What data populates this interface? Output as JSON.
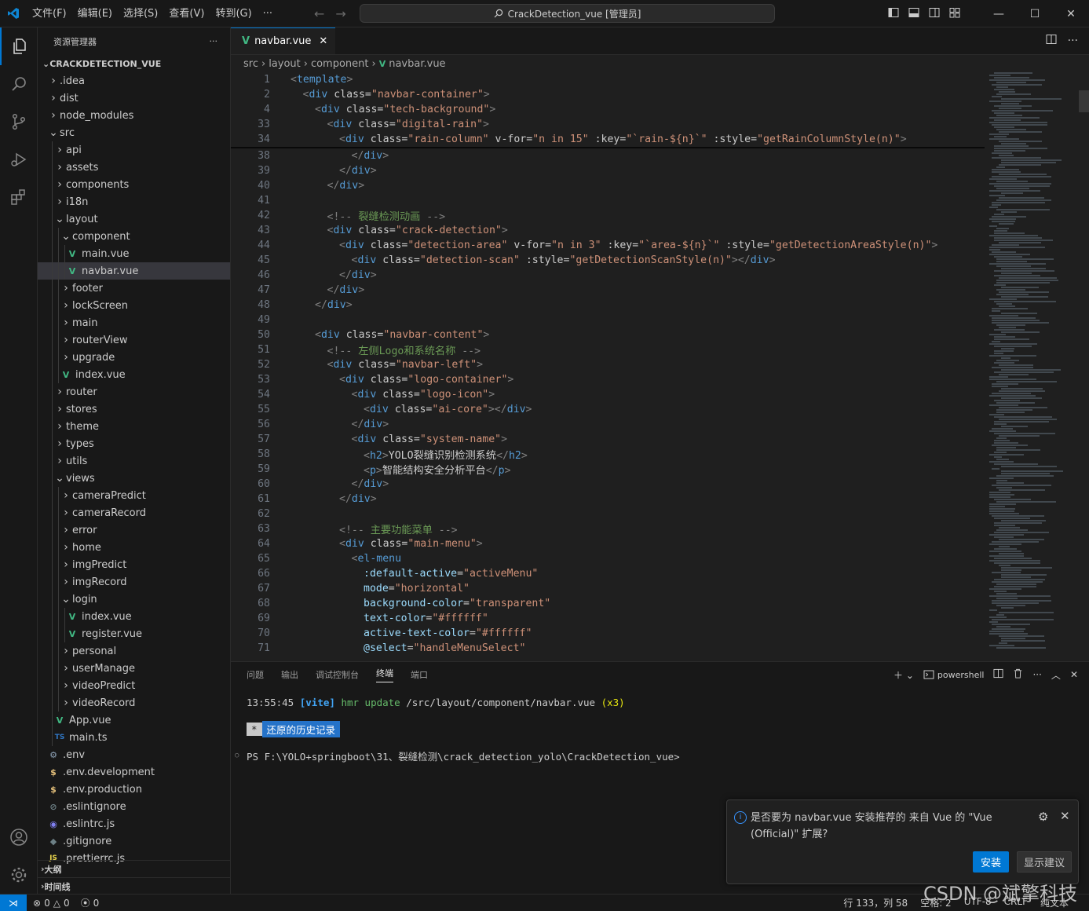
{
  "titlebar": {
    "menus": [
      "文件(F)",
      "编辑(E)",
      "选择(S)",
      "查看(V)",
      "转到(G)",
      "···"
    ],
    "search": "CrackDetection_vue [管理员]"
  },
  "sidebar": {
    "title": "资源管理器",
    "project": "CRACKDETECTION_VUE",
    "tree": [
      {
        "label": ".idea",
        "depth": 0,
        "kind": "folder"
      },
      {
        "label": "dist",
        "depth": 0,
        "kind": "folder"
      },
      {
        "label": "node_modules",
        "depth": 0,
        "kind": "folder"
      },
      {
        "label": "src",
        "depth": 0,
        "kind": "folder-open"
      },
      {
        "label": "api",
        "depth": 1,
        "kind": "folder"
      },
      {
        "label": "assets",
        "depth": 1,
        "kind": "folder"
      },
      {
        "label": "components",
        "depth": 1,
        "kind": "folder"
      },
      {
        "label": "i18n",
        "depth": 1,
        "kind": "folder"
      },
      {
        "label": "layout",
        "depth": 1,
        "kind": "folder-open"
      },
      {
        "label": "component",
        "depth": 2,
        "kind": "folder-open"
      },
      {
        "label": "main.vue",
        "depth": 3,
        "kind": "vue"
      },
      {
        "label": "navbar.vue",
        "depth": 3,
        "kind": "vue",
        "selected": true
      },
      {
        "label": "footer",
        "depth": 2,
        "kind": "folder"
      },
      {
        "label": "lockScreen",
        "depth": 2,
        "kind": "folder"
      },
      {
        "label": "main",
        "depth": 2,
        "kind": "folder"
      },
      {
        "label": "routerView",
        "depth": 2,
        "kind": "folder"
      },
      {
        "label": "upgrade",
        "depth": 2,
        "kind": "folder"
      },
      {
        "label": "index.vue",
        "depth": 2,
        "kind": "vue"
      },
      {
        "label": "router",
        "depth": 1,
        "kind": "folder"
      },
      {
        "label": "stores",
        "depth": 1,
        "kind": "folder"
      },
      {
        "label": "theme",
        "depth": 1,
        "kind": "folder"
      },
      {
        "label": "types",
        "depth": 1,
        "kind": "folder"
      },
      {
        "label": "utils",
        "depth": 1,
        "kind": "folder"
      },
      {
        "label": "views",
        "depth": 1,
        "kind": "folder-open"
      },
      {
        "label": "cameraPredict",
        "depth": 2,
        "kind": "folder"
      },
      {
        "label": "cameraRecord",
        "depth": 2,
        "kind": "folder"
      },
      {
        "label": "error",
        "depth": 2,
        "kind": "folder"
      },
      {
        "label": "home",
        "depth": 2,
        "kind": "folder"
      },
      {
        "label": "imgPredict",
        "depth": 2,
        "kind": "folder"
      },
      {
        "label": "imgRecord",
        "depth": 2,
        "kind": "folder"
      },
      {
        "label": "login",
        "depth": 2,
        "kind": "folder-open"
      },
      {
        "label": "index.vue",
        "depth": 3,
        "kind": "vue"
      },
      {
        "label": "register.vue",
        "depth": 3,
        "kind": "vue"
      },
      {
        "label": "personal",
        "depth": 2,
        "kind": "folder"
      },
      {
        "label": "userManage",
        "depth": 2,
        "kind": "folder"
      },
      {
        "label": "videoPredict",
        "depth": 2,
        "kind": "folder"
      },
      {
        "label": "videoRecord",
        "depth": 2,
        "kind": "folder"
      },
      {
        "label": "App.vue",
        "depth": 1,
        "kind": "vue"
      },
      {
        "label": "main.ts",
        "depth": 1,
        "kind": "ts"
      },
      {
        "label": ".env",
        "depth": 0,
        "kind": "env"
      },
      {
        "label": ".env.development",
        "depth": 0,
        "kind": "dollar"
      },
      {
        "label": ".env.production",
        "depth": 0,
        "kind": "dollar"
      },
      {
        "label": ".eslintignore",
        "depth": 0,
        "kind": "gray"
      },
      {
        "label": ".eslintrc.js",
        "depth": 0,
        "kind": "eslint"
      },
      {
        "label": ".gitignore",
        "depth": 0,
        "kind": "git"
      },
      {
        "label": ".prettierrc.js",
        "depth": 0,
        "kind": "js"
      }
    ],
    "outline": "大纲",
    "timeline": "时间线"
  },
  "editor": {
    "tab": "navbar.vue",
    "breadcrumbs": [
      "src",
      "layout",
      "component",
      "navbar.vue"
    ],
    "sticky": [
      {
        "n": "1",
        "indent": 0,
        "code": "<template>"
      },
      {
        "n": "2",
        "indent": 1,
        "code": "<div class=\"navbar-container\">"
      },
      {
        "n": "4",
        "indent": 2,
        "code": "<div class=\"tech-background\">"
      },
      {
        "n": "33",
        "indent": 3,
        "code": "<div class=\"digital-rain\">"
      },
      {
        "n": "34",
        "indent": 4,
        "code": "<div class=\"rain-column\" v-for=\"n in 15\" :key=\"`rain-${n}`\" :style=\"getRainColumnStyle(n)\">"
      }
    ],
    "lines": [
      {
        "n": "38",
        "indent": 5,
        "code": "</div>"
      },
      {
        "n": "39",
        "indent": 4,
        "code": "</div>"
      },
      {
        "n": "40",
        "indent": 3,
        "code": "</div>"
      },
      {
        "n": "41",
        "indent": 0,
        "code": ""
      },
      {
        "n": "42",
        "indent": 3,
        "code": "<!-- 裂缝检测动画 -->"
      },
      {
        "n": "43",
        "indent": 3,
        "code": "<div class=\"crack-detection\">"
      },
      {
        "n": "44",
        "indent": 4,
        "code": "<div class=\"detection-area\" v-for=\"n in 3\" :key=\"`area-${n}`\" :style=\"getDetectionAreaStyle(n)\">"
      },
      {
        "n": "45",
        "indent": 5,
        "code": "<div class=\"detection-scan\" :style=\"getDetectionScanStyle(n)\"></div>"
      },
      {
        "n": "46",
        "indent": 4,
        "code": "</div>"
      },
      {
        "n": "47",
        "indent": 3,
        "code": "</div>"
      },
      {
        "n": "48",
        "indent": 2,
        "code": "</div>"
      },
      {
        "n": "49",
        "indent": 0,
        "code": ""
      },
      {
        "n": "50",
        "indent": 2,
        "code": "<div class=\"navbar-content\">"
      },
      {
        "n": "51",
        "indent": 3,
        "code": "<!-- 左侧Logo和系统名称 -->"
      },
      {
        "n": "52",
        "indent": 3,
        "code": "<div class=\"navbar-left\">"
      },
      {
        "n": "53",
        "indent": 4,
        "code": "<div class=\"logo-container\">"
      },
      {
        "n": "54",
        "indent": 5,
        "code": "<div class=\"logo-icon\">"
      },
      {
        "n": "55",
        "indent": 6,
        "code": "<div class=\"ai-core\"></div>"
      },
      {
        "n": "56",
        "indent": 5,
        "code": "</div>"
      },
      {
        "n": "57",
        "indent": 5,
        "code": "<div class=\"system-name\">"
      },
      {
        "n": "58",
        "indent": 6,
        "code": "<h2>YOLO裂缝识别检测系统</h2>"
      },
      {
        "n": "59",
        "indent": 6,
        "code": "<p>智能结构安全分析平台</p>"
      },
      {
        "n": "60",
        "indent": 5,
        "code": "</div>"
      },
      {
        "n": "61",
        "indent": 4,
        "code": "</div>"
      },
      {
        "n": "62",
        "indent": 0,
        "code": ""
      },
      {
        "n": "63",
        "indent": 4,
        "code": "<!-- 主要功能菜单 -->"
      },
      {
        "n": "64",
        "indent": 4,
        "code": "<div class=\"main-menu\">"
      },
      {
        "n": "65",
        "indent": 5,
        "code": "<el-menu"
      },
      {
        "n": "66",
        "indent": 6,
        "code": ":default-active=\"activeMenu\""
      },
      {
        "n": "67",
        "indent": 6,
        "code": "mode=\"horizontal\""
      },
      {
        "n": "68",
        "indent": 6,
        "code": "background-color=\"transparent\""
      },
      {
        "n": "69",
        "indent": 6,
        "code": "text-color=\"#ffffff\""
      },
      {
        "n": "70",
        "indent": 6,
        "code": "active-text-color=\"#ffffff\""
      },
      {
        "n": "71",
        "indent": 6,
        "code": "@select=\"handleMenuSelect\""
      }
    ]
  },
  "panel": {
    "tabs": [
      "问题",
      "输出",
      "调试控制台",
      "终端",
      "端口"
    ],
    "active_tab": "终端",
    "shell": "powershell",
    "term_time": "13:55:45",
    "term_vite": "[vite]",
    "term_hmr": "hmr update",
    "term_path": "/src/layout/component/navbar.vue",
    "term_count": "(x3)",
    "history_star": "*",
    "history_label": "还原的历史记录",
    "prompt": "PS F:\\YOLO+springboot\\31、裂缝检测\\crack_detection_yolo\\CrackDetection_vue>"
  },
  "notification": {
    "message": "是否要为 navbar.vue 安装推荐的 来自 Vue 的 \"Vue (Official)\" 扩展?",
    "install": "安装",
    "show": "显示建议"
  },
  "status": {
    "errors": "0",
    "warnings": "0",
    "ports": "0",
    "position": "行 133，列 58",
    "spaces": "空格: 2",
    "encoding": "UTF-8",
    "eol": "CRLF",
    "language": "纯文本"
  },
  "watermark": "CSDN @斌擎科技"
}
